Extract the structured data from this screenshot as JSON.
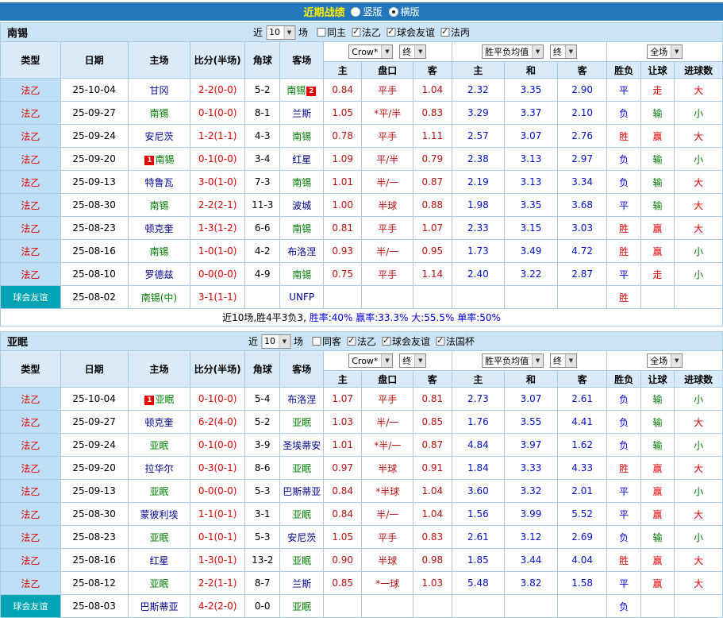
{
  "titlebar": {
    "title": "近期战绩",
    "options": [
      {
        "label": "竖版",
        "selected": false
      },
      {
        "label": "横版",
        "selected": true
      }
    ]
  },
  "shared": {
    "near": "近",
    "count": "10",
    "matches": "场"
  },
  "selects": {
    "bookmaker": "Crow*",
    "final": "终",
    "wdl": "胜平负均值",
    "scope": "全场"
  },
  "columns": {
    "main": [
      "类型",
      "日期",
      "主场",
      "比分(半场)",
      "角球",
      "客场"
    ],
    "sub": [
      "主",
      "盘口",
      "客",
      "主",
      "和",
      "客",
      "胜负",
      "让球",
      "进球数"
    ]
  },
  "value_colors": {
    "胜": "#e10000",
    "赢": "#e10000",
    "大": "#e10000",
    "平": "#0000e1",
    "负": "#0000e1",
    "走": "#e10000",
    "输": "#007800",
    "小": "#007800"
  },
  "sections": [
    {
      "team": "南锡",
      "filters": [
        {
          "label": "同主",
          "checked": false
        },
        {
          "label": "法乙",
          "checked": true
        },
        {
          "label": "球会友谊",
          "checked": true
        },
        {
          "label": "法丙",
          "checked": true
        }
      ],
      "rows": [
        {
          "lg": "法乙",
          "friendly": false,
          "date": "25-10-04",
          "home": {
            "name": "甘冈",
            "focus": false
          },
          "score": "2-2(0-0)",
          "corner": "5-2",
          "away": {
            "name": "南锡",
            "focus": true,
            "badge": "2"
          },
          "asian": [
            "0.84",
            "平手",
            "1.04"
          ],
          "euro": [
            "2.32",
            "3.35",
            "2.90"
          ],
          "res": "平",
          "let": "走",
          "big": "大"
        },
        {
          "lg": "法乙",
          "friendly": false,
          "date": "25-09-27",
          "home": {
            "name": "南锡",
            "focus": true
          },
          "score": "0-1(0-0)",
          "corner": "8-1",
          "away": {
            "name": "兰斯",
            "focus": false
          },
          "asian": [
            "1.05",
            "*平/半",
            "0.83"
          ],
          "euro": [
            "3.29",
            "3.37",
            "2.10"
          ],
          "res": "负",
          "let": "输",
          "big": "小"
        },
        {
          "lg": "法乙",
          "friendly": false,
          "date": "25-09-24",
          "home": {
            "name": "安尼茨",
            "focus": false
          },
          "score": "1-2(1-1)",
          "corner": "4-3",
          "away": {
            "name": "南锡",
            "focus": true
          },
          "asian": [
            "0.78",
            "平手",
            "1.11"
          ],
          "euro": [
            "2.57",
            "3.07",
            "2.76"
          ],
          "res": "胜",
          "let": "赢",
          "big": "大"
        },
        {
          "lg": "法乙",
          "friendly": false,
          "date": "25-09-20",
          "home": {
            "name": "南锡",
            "focus": true,
            "badge": "1"
          },
          "score": "0-1(0-0)",
          "corner": "3-4",
          "away": {
            "name": "红星",
            "focus": false
          },
          "asian": [
            "1.09",
            "平/半",
            "0.79"
          ],
          "euro": [
            "2.38",
            "3.13",
            "2.97"
          ],
          "res": "负",
          "let": "输",
          "big": "小"
        },
        {
          "lg": "法乙",
          "friendly": false,
          "date": "25-09-13",
          "home": {
            "name": "特鲁瓦",
            "focus": false
          },
          "score": "3-0(1-0)",
          "corner": "7-3",
          "away": {
            "name": "南锡",
            "focus": true
          },
          "asian": [
            "1.01",
            "半/一",
            "0.87"
          ],
          "euro": [
            "2.19",
            "3.13",
            "3.34"
          ],
          "res": "负",
          "let": "输",
          "big": "大"
        },
        {
          "lg": "法乙",
          "friendly": false,
          "date": "25-08-30",
          "home": {
            "name": "南锡",
            "focus": true
          },
          "score": "2-2(2-1)",
          "corner": "11-3",
          "away": {
            "name": "波城",
            "focus": false
          },
          "asian": [
            "1.00",
            "半球",
            "0.88"
          ],
          "euro": [
            "1.98",
            "3.35",
            "3.68"
          ],
          "res": "平",
          "let": "输",
          "big": "大"
        },
        {
          "lg": "法乙",
          "friendly": false,
          "date": "25-08-23",
          "home": {
            "name": "顿克奎",
            "focus": false
          },
          "score": "1-3(1-2)",
          "corner": "6-6",
          "away": {
            "name": "南锡",
            "focus": true
          },
          "asian": [
            "0.81",
            "平手",
            "1.07"
          ],
          "euro": [
            "2.33",
            "3.15",
            "3.03"
          ],
          "res": "胜",
          "let": "赢",
          "big": "大"
        },
        {
          "lg": "法乙",
          "friendly": false,
          "date": "25-08-16",
          "home": {
            "name": "南锡",
            "focus": true
          },
          "score": "1-0(1-0)",
          "corner": "4-2",
          "away": {
            "name": "布洛涅",
            "focus": false
          },
          "asian": [
            "0.93",
            "半/一",
            "0.95"
          ],
          "euro": [
            "1.73",
            "3.49",
            "4.72"
          ],
          "res": "胜",
          "let": "赢",
          "big": "小"
        },
        {
          "lg": "法乙",
          "friendly": false,
          "date": "25-08-10",
          "home": {
            "name": "罗德兹",
            "focus": false
          },
          "score": "0-0(0-0)",
          "corner": "4-9",
          "away": {
            "name": "南锡",
            "focus": true
          },
          "asian": [
            "0.75",
            "平手",
            "1.14"
          ],
          "euro": [
            "2.40",
            "3.22",
            "2.87"
          ],
          "res": "平",
          "let": "走",
          "big": "小"
        },
        {
          "lg": "球会友谊",
          "friendly": true,
          "date": "25-08-02",
          "home": {
            "name": "南锡(中)",
            "focus": true
          },
          "score": "3-1(1-1)",
          "corner": "",
          "away": {
            "name": "UNFP",
            "focus": false
          },
          "asian": [
            "",
            "",
            ""
          ],
          "euro": [
            "",
            "",
            ""
          ],
          "res": "胜",
          "let": "",
          "big": ""
        }
      ],
      "summary": [
        {
          "t": "近10场,胜4平3负3, ",
          "c": "#000000"
        },
        {
          "t": "胜率:40% ",
          "c": "#0000e1"
        },
        {
          "t": "赢率:33.3% ",
          "c": "#0000e1"
        },
        {
          "t": "大:55.5% ",
          "c": "#0000e1"
        },
        {
          "t": "单率:50%",
          "c": "#0000e1"
        }
      ]
    },
    {
      "team": "亚眠",
      "filters": [
        {
          "label": "同客",
          "checked": false
        },
        {
          "label": "法乙",
          "checked": true
        },
        {
          "label": "球会友谊",
          "checked": true
        },
        {
          "label": "法国杯",
          "checked": true
        }
      ],
      "rows": [
        {
          "lg": "法乙",
          "friendly": false,
          "date": "25-10-04",
          "home": {
            "name": "亚眠",
            "focus": true,
            "badge": "1"
          },
          "score": "0-1(0-0)",
          "corner": "5-4",
          "away": {
            "name": "布洛涅",
            "focus": false
          },
          "asian": [
            "1.07",
            "平手",
            "0.81"
          ],
          "euro": [
            "2.73",
            "3.07",
            "2.61"
          ],
          "res": "负",
          "let": "输",
          "big": "小"
        },
        {
          "lg": "法乙",
          "friendly": false,
          "date": "25-09-27",
          "home": {
            "name": "顿克奎",
            "focus": false
          },
          "score": "6-2(4-0)",
          "corner": "5-2",
          "away": {
            "name": "亚眠",
            "focus": true
          },
          "asian": [
            "1.03",
            "半/一",
            "0.85"
          ],
          "euro": [
            "1.76",
            "3.55",
            "4.41"
          ],
          "res": "负",
          "let": "输",
          "big": "大"
        },
        {
          "lg": "法乙",
          "friendly": false,
          "date": "25-09-24",
          "home": {
            "name": "亚眠",
            "focus": true
          },
          "score": "0-1(0-0)",
          "corner": "3-9",
          "away": {
            "name": "圣埃蒂安",
            "focus": false
          },
          "asian": [
            "1.01",
            "*半/一",
            "0.87"
          ],
          "euro": [
            "4.84",
            "3.97",
            "1.62"
          ],
          "res": "负",
          "let": "输",
          "big": "小"
        },
        {
          "lg": "法乙",
          "friendly": false,
          "date": "25-09-20",
          "home": {
            "name": "拉华尔",
            "focus": false
          },
          "score": "0-3(0-1)",
          "corner": "8-6",
          "away": {
            "name": "亚眠",
            "focus": true
          },
          "asian": [
            "0.97",
            "半球",
            "0.91"
          ],
          "euro": [
            "1.84",
            "3.33",
            "4.33"
          ],
          "res": "胜",
          "let": "赢",
          "big": "大"
        },
        {
          "lg": "法乙",
          "friendly": false,
          "date": "25-09-13",
          "home": {
            "name": "亚眠",
            "focus": true
          },
          "score": "0-0(0-0)",
          "corner": "5-3",
          "away": {
            "name": "巴斯蒂亚",
            "focus": false
          },
          "asian": [
            "0.84",
            "*半球",
            "1.04"
          ],
          "euro": [
            "3.60",
            "3.32",
            "2.01"
          ],
          "res": "平",
          "let": "赢",
          "big": "小"
        },
        {
          "lg": "法乙",
          "friendly": false,
          "date": "25-08-30",
          "home": {
            "name": "蒙彼利埃",
            "focus": false
          },
          "score": "1-1(0-1)",
          "corner": "3-1",
          "away": {
            "name": "亚眠",
            "focus": true
          },
          "asian": [
            "0.84",
            "半/一",
            "1.04"
          ],
          "euro": [
            "1.56",
            "3.99",
            "5.52"
          ],
          "res": "平",
          "let": "赢",
          "big": "大"
        },
        {
          "lg": "法乙",
          "friendly": false,
          "date": "25-08-23",
          "home": {
            "name": "亚眠",
            "focus": true
          },
          "score": "0-1(0-1)",
          "corner": "5-3",
          "away": {
            "name": "安尼茨",
            "focus": false
          },
          "asian": [
            "1.05",
            "平手",
            "0.83"
          ],
          "euro": [
            "2.61",
            "3.12",
            "2.69"
          ],
          "res": "负",
          "let": "输",
          "big": "小"
        },
        {
          "lg": "法乙",
          "friendly": false,
          "date": "25-08-16",
          "home": {
            "name": "红星",
            "focus": false
          },
          "score": "1-3(0-1)",
          "corner": "13-2",
          "away": {
            "name": "亚眠",
            "focus": true
          },
          "asian": [
            "0.90",
            "半球",
            "0.98"
          ],
          "euro": [
            "1.85",
            "3.44",
            "4.04"
          ],
          "res": "胜",
          "let": "赢",
          "big": "大"
        },
        {
          "lg": "法乙",
          "friendly": false,
          "date": "25-08-12",
          "home": {
            "name": "亚眠",
            "focus": true
          },
          "score": "2-2(1-1)",
          "corner": "8-7",
          "away": {
            "name": "兰斯",
            "focus": false
          },
          "asian": [
            "0.85",
            "*一球",
            "1.03"
          ],
          "euro": [
            "5.48",
            "3.82",
            "1.58"
          ],
          "res": "平",
          "let": "赢",
          "big": "大"
        },
        {
          "lg": "球会友谊",
          "friendly": true,
          "date": "25-08-03",
          "home": {
            "name": "巴斯蒂亚",
            "focus": false
          },
          "score": "4-2(2-0)",
          "corner": "0-0",
          "away": {
            "name": "亚眠",
            "focus": true
          },
          "asian": [
            "",
            "",
            ""
          ],
          "euro": [
            "",
            "",
            ""
          ],
          "res": "负",
          "let": "",
          "big": ""
        }
      ]
    }
  ]
}
